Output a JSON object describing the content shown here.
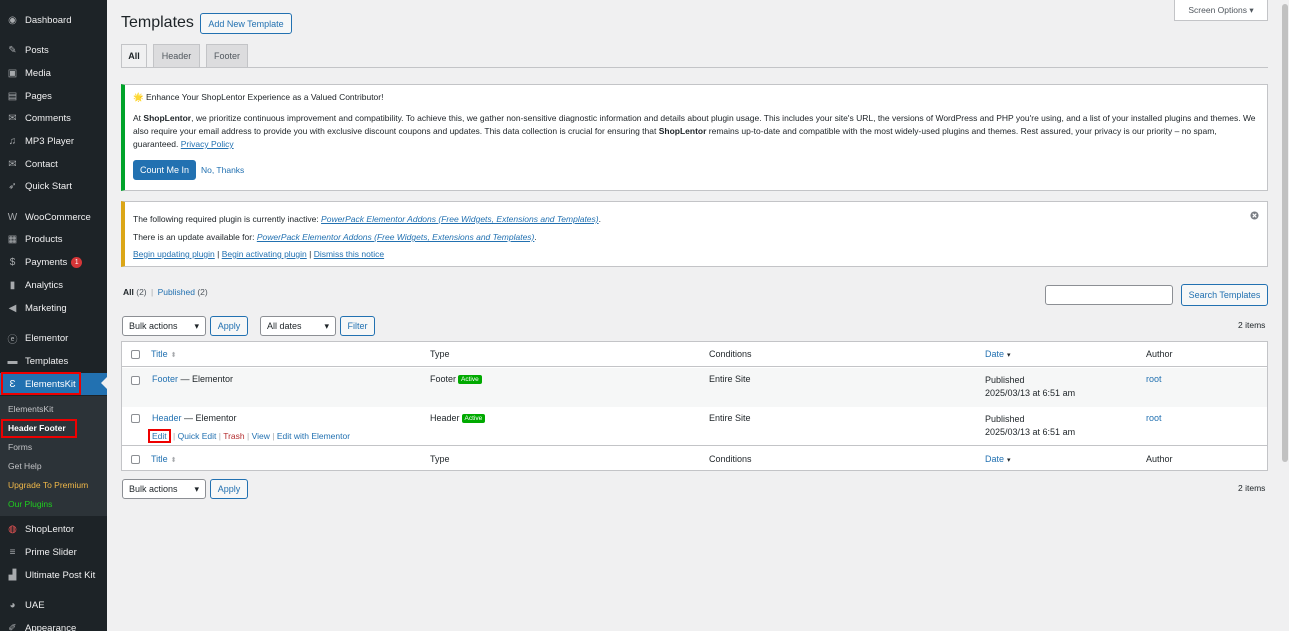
{
  "sidebar": {
    "items": [
      {
        "label": "Dashboard",
        "icon": "dashboard-icon",
        "glyph": "◉"
      },
      {
        "label": "Posts",
        "icon": "pin-icon",
        "glyph": "✎"
      },
      {
        "label": "Media",
        "icon": "media-icon",
        "glyph": "▣"
      },
      {
        "label": "Pages",
        "icon": "pages-icon",
        "glyph": "▤"
      },
      {
        "label": "Comments",
        "icon": "comments-icon",
        "glyph": "✉"
      },
      {
        "label": "MP3 Player",
        "icon": "audio-icon",
        "glyph": "♫"
      },
      {
        "label": "Contact",
        "icon": "mail-icon",
        "glyph": "✉"
      },
      {
        "label": "Quick Start",
        "icon": "rocket-icon",
        "glyph": "➶"
      },
      {
        "label": "WooCommerce",
        "icon": "woo-icon",
        "glyph": "W"
      },
      {
        "label": "Products",
        "icon": "box-icon",
        "glyph": "▦"
      },
      {
        "label": "Payments",
        "icon": "dollar-icon",
        "glyph": "$",
        "badge": "1"
      },
      {
        "label": "Analytics",
        "icon": "bar-chart-icon",
        "glyph": "▮"
      },
      {
        "label": "Marketing",
        "icon": "megaphone-icon",
        "glyph": "◀"
      },
      {
        "label": "Elementor",
        "icon": "elementor-icon",
        "glyph": "ⓔ"
      },
      {
        "label": "Templates",
        "icon": "folder-icon",
        "glyph": "▬"
      },
      {
        "label": "ElementsKit",
        "icon": "elementskit-icon",
        "glyph": "Ɛ"
      }
    ],
    "submenu": [
      {
        "label": "ElementsKit",
        "color": "#c3c4c7"
      },
      {
        "label": "Header Footer",
        "color": "#ffffff"
      },
      {
        "label": "Forms",
        "color": "#c3c4c7"
      },
      {
        "label": "Get Help",
        "color": "#c3c4c7"
      },
      {
        "label": "Upgrade To Premium",
        "color": "#f0b849"
      },
      {
        "label": "Our Plugins",
        "color": "#1fd01f"
      }
    ],
    "items_after": [
      {
        "label": "ShopLentor",
        "icon": "shoplentor-icon",
        "glyph": "◍"
      },
      {
        "label": "Prime Slider",
        "icon": "prime-slider-icon",
        "glyph": "≡"
      },
      {
        "label": "Ultimate Post Kit",
        "icon": "post-kit-icon",
        "glyph": "▟"
      },
      {
        "label": "UAE",
        "icon": "uae-icon",
        "glyph": "◕"
      },
      {
        "label": "Appearance",
        "icon": "brush-icon",
        "glyph": "✐"
      }
    ]
  },
  "header": {
    "title": "Templates",
    "add_new": "Add New Template",
    "screen_options": "Screen Options ▾"
  },
  "tabs": [
    "All",
    "Header",
    "Footer"
  ],
  "notice1": {
    "title": "🌟 Enhance Your ShopLentor Experience as a Valued Contributor!",
    "body_lead": "At ",
    "brand": "ShopLentor",
    "body_1": ", we prioritize continuous improvement and compatibility. To achieve this, we gather non-sensitive diagnostic information and details about plugin usage. This includes your site's URL, the versions of WordPress and PHP you're using, and a list of your installed plugins and themes. We also require your email address to provide you with exclusive discount coupons and updates. This data collection is crucial for ensuring that ",
    "body_2": " remains up-to-date and compatible with the most widely-used plugins and themes. Rest assured, your privacy is our priority – no spam, guaranteed. ",
    "privacy": "Privacy Policy",
    "count_me_in": "Count Me In",
    "no_thanks": "No, Thanks"
  },
  "notice2": {
    "line1_text": "The following required plugin is currently inactive: ",
    "line1_link": "PowerPack Elementor Addons (Free Widgets, Extensions and Templates)",
    "line2_text": "There is an update available for: ",
    "line2_link": "PowerPack Elementor Addons (Free Widgets, Extensions and Templates)",
    "begin_updating": "Begin updating plugin",
    "begin_activating": "Begin activating plugin",
    "dismiss": "Dismiss this notice",
    "sep": " | ",
    "period": "."
  },
  "filters": {
    "all": "All",
    "all_count": "(2)",
    "published": "Published",
    "published_count": "(2)",
    "sep": "|",
    "search_button": "Search Templates",
    "bulk_actions": "Bulk actions",
    "apply": "Apply",
    "all_dates": "All dates",
    "filter": "Filter",
    "items_count": "2 items"
  },
  "table": {
    "columns": {
      "title": "Title",
      "type": "Type",
      "conditions": "Conditions",
      "date": "Date",
      "author": "Author"
    },
    "rows": [
      {
        "title": "Footer",
        "suffix": " — Elementor",
        "type": "Footer",
        "status": "Active",
        "conditions": "Entire Site",
        "date_status": "Published",
        "date": "2025/03/13 at 6:51 am",
        "author": "root"
      },
      {
        "title": "Header",
        "suffix": " — Elementor",
        "type": "Header",
        "status": "Active",
        "conditions": "Entire Site",
        "date_status": "Published",
        "date": "2025/03/13 at 6:51 am",
        "author": "root"
      }
    ],
    "row_actions": {
      "edit": "Edit",
      "quick_edit": "Quick Edit",
      "trash": "Trash",
      "view": "View",
      "edit_elementor": "Edit with Elementor",
      "sep": "|"
    }
  },
  "colors": {
    "accent": "#2271b1",
    "notice_success": "#00a32a",
    "notice_warning": "#dba617",
    "active_pill": "#00aa00"
  }
}
